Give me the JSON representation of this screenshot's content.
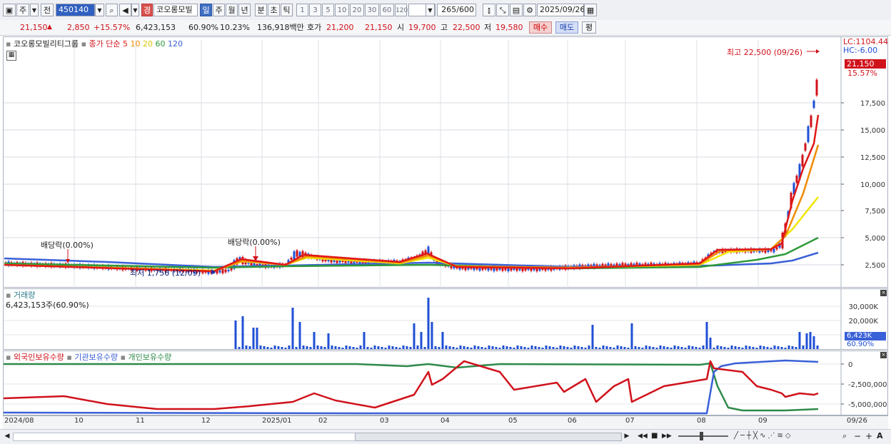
{
  "toolbar": {
    "period_toggle": "주",
    "prev_label": "전",
    "code": "450140",
    "badge": "경",
    "stock_name": "코오롱모빌",
    "periods": [
      {
        "label": "일",
        "selected": true
      },
      {
        "label": "주",
        "selected": false
      },
      {
        "label": "월",
        "selected": false
      },
      {
        "label": "년",
        "selected": false
      },
      {
        "label": "분",
        "selected": false
      },
      {
        "label": "초",
        "selected": false
      },
      {
        "label": "틱",
        "selected": false
      }
    ],
    "intervals": [
      "1",
      "3",
      "5",
      "10",
      "20",
      "30",
      "60",
      "120"
    ],
    "count": "265",
    "count_total": "/600",
    "date": "2025/09/26"
  },
  "quote": {
    "price": "21,150",
    "change": "2,850",
    "change_pct": "+15.57%",
    "volume": "6,423,153",
    "volume_ratio": "60.90%",
    "turnover": "10.23%",
    "amount": "136,918백만",
    "bid_label": "호가",
    "bid1": "21,200",
    "bid2": "21,150",
    "open_label": "시",
    "open": "19,700",
    "high_label": "고",
    "high": "22,500",
    "low_label": "저",
    "low": "19,580",
    "buy_label": "매수",
    "sell_label": "매도",
    "eval_label": "평"
  },
  "price_panel": {
    "title": "코오롱모빌리티그룹",
    "legend_prefix": "종가 단순",
    "ma_labels": [
      "5",
      "10",
      "20",
      "60",
      "120"
    ],
    "ma_colors": [
      "#e01818",
      "#f08a00",
      "#f2e400",
      "#2e9a3a",
      "#3a60d8"
    ],
    "lc": "LC:1104.44",
    "hc": "HC:-6.00",
    "price_tag": "21,150",
    "pct_tag": "15.57%",
    "high_annot": "최고 22,500 (09/26)",
    "low_annot": "최저 1,756 (12/09)",
    "div_annot_1": "배당락(0.00%)",
    "div_annot_2": "배당락(0.00%)",
    "y_ticks": [
      "17,500",
      "15,000",
      "12,500",
      "10,000",
      "7,500",
      "5,000",
      "2,500"
    ]
  },
  "volume_panel": {
    "title": "거래량",
    "value": "6,423,153주(60.90%)",
    "y_ticks": [
      "30,000K",
      "20,000K",
      "10,000K"
    ],
    "tag_value": "6,423K",
    "tag_pct": "60.90%"
  },
  "holder_panel": {
    "labels": [
      "외국인보유수량",
      "기관보유수량",
      "개인보유수량"
    ],
    "colors": [
      "#d0121b",
      "#3a60d8",
      "#2e8a4a"
    ],
    "y_ticks": [
      "0",
      "-2,500,000",
      "-5,000,000"
    ]
  },
  "x_axis": {
    "labels": [
      "2024/08",
      "10",
      "11",
      "12",
      "2025/01",
      "02",
      "03",
      "04",
      "05",
      "06",
      "07",
      "08",
      "09"
    ],
    "last_date": "09/26"
  }
}
